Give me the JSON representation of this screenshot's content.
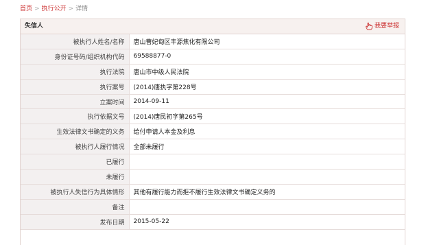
{
  "breadcrumb": {
    "home": "首页",
    "section": "执行公开",
    "current": "详情",
    "sep": ">"
  },
  "panel": {
    "title": "失信人",
    "report_label": "我要举报",
    "report_icon": "hand-pointer-icon"
  },
  "rows": [
    {
      "label": "被执行人姓名/名称",
      "value": "唐山曹妃甸区丰源焦化有限公司"
    },
    {
      "label": "身份证号码/组织机构代码",
      "value": "69588877-0"
    },
    {
      "label": "执行法院",
      "value": "唐山市中级人民法院"
    },
    {
      "label": "执行案号",
      "value": "(2014)唐执字第228号"
    },
    {
      "label": "立案时间",
      "value": "2014-09-11"
    },
    {
      "label": "执行依据文号",
      "value": "(2014)唐民初字第265号"
    },
    {
      "label": "生效法律文书确定的义务",
      "value": "给付申请人本金及利息"
    },
    {
      "label": "被执行人履行情况",
      "value": "全部未履行"
    },
    {
      "label": "已履行",
      "value": ""
    },
    {
      "label": "未履行",
      "value": ""
    },
    {
      "label": "被执行人失信行为具体情形",
      "value": "其他有履行能力而拒不履行生效法律文书确定义务的"
    },
    {
      "label": "备注",
      "value": ""
    },
    {
      "label": "发布日期",
      "value": "2015-05-22"
    }
  ],
  "colors": {
    "accent": "#cc3333",
    "label_bg": "#f3f0f0",
    "header_bg": "#f7f1ef"
  }
}
